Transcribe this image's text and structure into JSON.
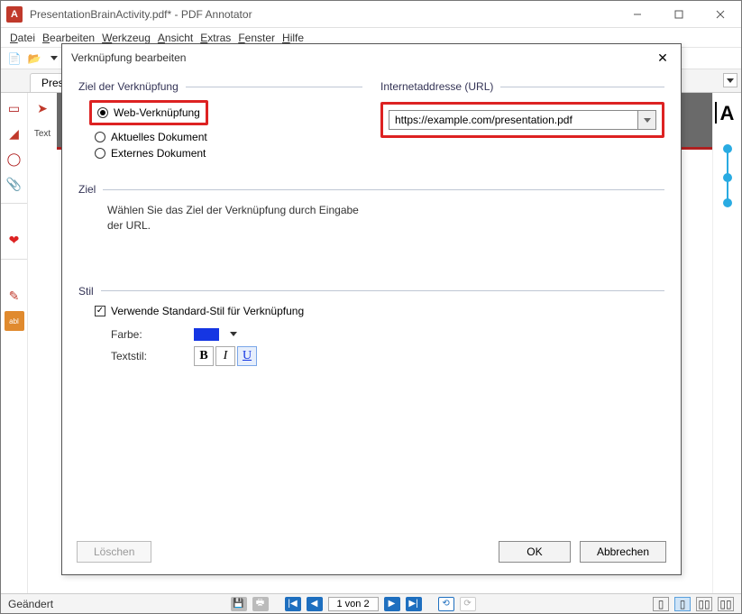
{
  "window": {
    "title": "PresentationBrainActivity.pdf* - PDF Annotator",
    "status_left": "Geändert",
    "page_indicator": "1 von 2"
  },
  "menubar": [
    "Datei",
    "Bearbeiten",
    "Werkzeug",
    "Ansicht",
    "Extras",
    "Fenster",
    "Hilfe"
  ],
  "tab": {
    "label": "Prese"
  },
  "left_tools": {
    "text_label": "Text"
  },
  "dialog": {
    "title": "Verknüpfung bearbeiten",
    "groups": {
      "target_type": {
        "heading": "Ziel der Verknüpfung",
        "options": {
          "web": "Web-Verknüpfung",
          "current": "Aktuelles Dokument",
          "external": "Externes Dokument"
        }
      },
      "url": {
        "heading": "Internetaddresse (URL)",
        "value": "https://example.com/presentation.pdf"
      },
      "ziel": {
        "heading": "Ziel",
        "hint": "Wählen Sie das Ziel der Verknüpfung durch Eingabe der URL."
      },
      "stil": {
        "heading": "Stil",
        "use_default": "Verwende Standard-Stil für Verknüpfung",
        "color_label": "Farbe:",
        "textstyle_label": "Textstil:",
        "b": "B",
        "i": "I",
        "u": "U"
      }
    },
    "buttons": {
      "delete": "Löschen",
      "ok": "OK",
      "cancel": "Abbrechen"
    }
  }
}
